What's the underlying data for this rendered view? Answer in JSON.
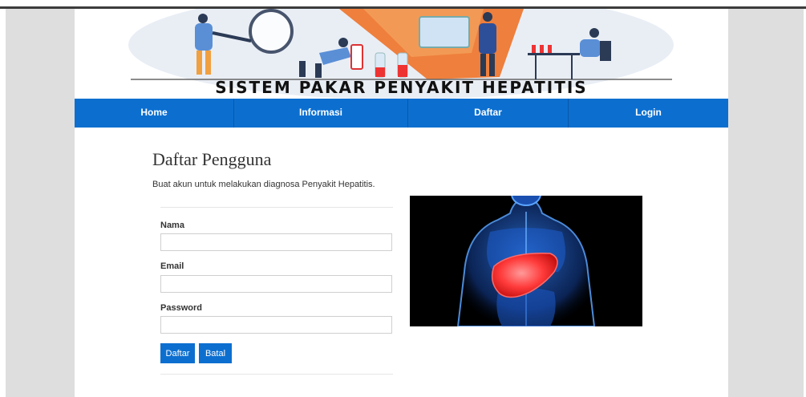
{
  "banner": {
    "title": "SISTEM PAKAR PENYAKIT HEPATITIS"
  },
  "nav": {
    "items": [
      "Home",
      "Informasi",
      "Daftar",
      "Login"
    ]
  },
  "main": {
    "heading": "Daftar Pengguna",
    "subtitle": "Buat akun untuk melakukan diagnosa Penyakit Hepatitis.",
    "form": {
      "name_label": "Nama",
      "name_value": "",
      "email_label": "Email",
      "email_value": "",
      "password_label": "Password",
      "password_value": "",
      "submit_label": "Daftar",
      "cancel_label": "Batal"
    }
  },
  "colors": {
    "nav": "#0c6fd0",
    "accent_button": "#0c6fd0",
    "side": "#dedede"
  }
}
